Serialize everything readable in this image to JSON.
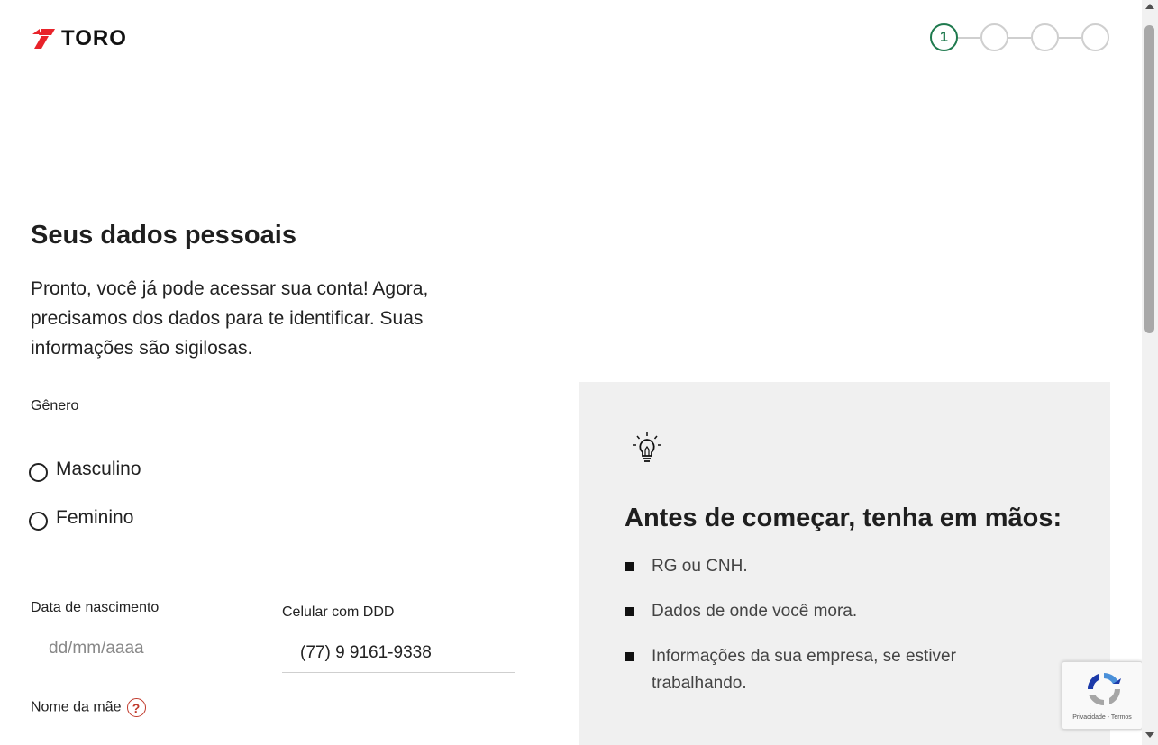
{
  "header": {
    "logo_text": "TORO",
    "steps": [
      "1",
      "",
      "",
      ""
    ]
  },
  "main": {
    "title": "Seus dados pessoais",
    "intro": "Pronto, você já pode acessar sua conta! Agora, precisamos dos dados para te identificar. Suas informações são sigilosas.",
    "gender_label": "Gênero",
    "gender_options": [
      "Masculino",
      "Feminino"
    ],
    "birth_label": "Data de nascimento",
    "birth_placeholder": "dd/mm/aaaa",
    "phone_label": "Celular com DDD",
    "phone_value": "(77) 9 9161-9338",
    "mother_label": "Nome da mãe",
    "help_icon_glyph": "?"
  },
  "tips": {
    "title": "Antes de começar, tenha em mãos:",
    "items": [
      "RG ou CNH.",
      "Dados de onde você mora.",
      "Informações da sua empresa, se estiver trabalhando."
    ]
  },
  "recaptcha": {
    "footer": "Privacidade - Termos"
  },
  "colors": {
    "brand_red": "#e8232a",
    "step_active": "#1f7a4e",
    "panel_bg": "#f0f0f0"
  }
}
